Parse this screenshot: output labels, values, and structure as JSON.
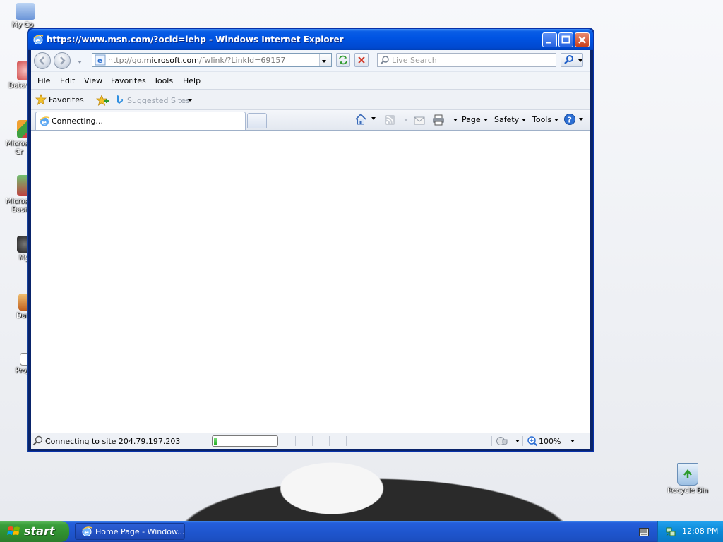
{
  "desktop": {
    "icons": [
      {
        "label": "My Co"
      },
      {
        "label": "Datawi"
      },
      {
        "label": "Microso\nCr"
      },
      {
        "label": "Microso\nBasi"
      },
      {
        "label": "My"
      },
      {
        "label": "Dar"
      },
      {
        "label": "Proj"
      }
    ],
    "recycle_bin_label": "Recycle Bin"
  },
  "window": {
    "title": "https://www.msn.com/?ocid=iehp - Windows Internet Explorer"
  },
  "address": {
    "prefix": "http://go.",
    "domain": "microsoft.com",
    "suffix": "/fwlink/?LinkId=69157"
  },
  "search": {
    "placeholder": "Live Search"
  },
  "menu": {
    "items": [
      "File",
      "Edit",
      "View",
      "Favorites",
      "Tools",
      "Help"
    ]
  },
  "favorites_bar": {
    "favorites_label": "Favorites",
    "suggested_sites_label": "Suggested Sites"
  },
  "tabs": {
    "active_label": "Connecting..."
  },
  "command_bar": {
    "page_label": "Page",
    "safety_label": "Safety",
    "tools_label": "Tools"
  },
  "status": {
    "text": "Connecting to site 204.79.197.203",
    "progress": 0.06,
    "zoom": "100%"
  },
  "taskbar": {
    "start_label": "start",
    "task_label": "Home Page - Window...",
    "clock": "12:08 PM"
  },
  "colors": {
    "title_bar": "#0054e3",
    "taskbar": "#245edb",
    "start_button": "#3a9e3a",
    "tray": "#0c8ad8",
    "progress": "#29b029"
  }
}
